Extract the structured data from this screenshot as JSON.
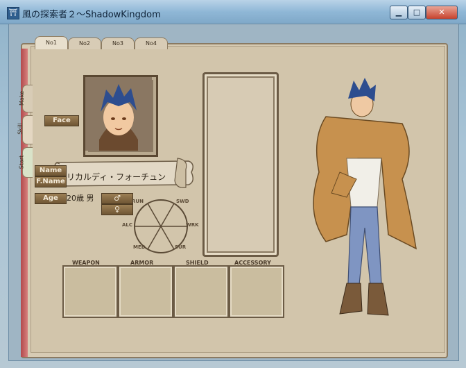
{
  "window": {
    "title": "風の探索者２～ShadowKingdom",
    "icon": "app-icon"
  },
  "window_controls": {
    "minimize": "▁",
    "maximize": "□",
    "close": "✕"
  },
  "tabs": [
    {
      "label": "No1",
      "active": true
    },
    {
      "label": "No2"
    },
    {
      "label": "No3"
    },
    {
      "label": "No4"
    }
  ],
  "side_tabs": [
    {
      "label": "Make"
    },
    {
      "label": "Skill"
    },
    {
      "label": "Start"
    }
  ],
  "buttons": {
    "face": "Face",
    "name": "Name",
    "fname": "F.Name",
    "age": "Age"
  },
  "character": {
    "name": "リカルディ・フォーチュン",
    "age_gender": "20歳 男",
    "male_symbol": "♂",
    "female_symbol": "♀"
  },
  "radar_labels": {
    "top_left": "RUN",
    "top_right": "SWD",
    "left": "ALC",
    "right": "WRK",
    "bottom_left": "MED",
    "bottom_right": "SUR"
  },
  "equipment": {
    "weapon": "WEAPON",
    "armor": "ARMOR",
    "shield": "SHIELD",
    "accessory": "ACCESSORY"
  }
}
